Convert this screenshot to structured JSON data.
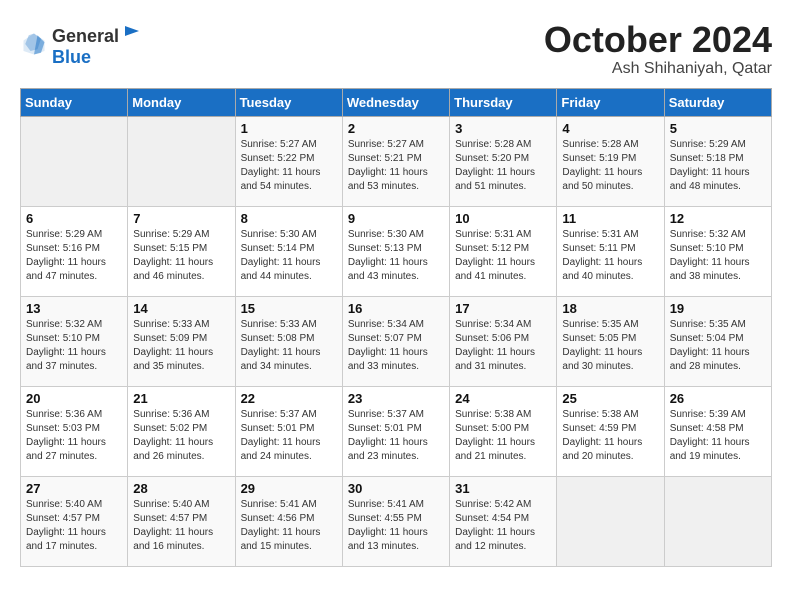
{
  "logo": {
    "general": "General",
    "blue": "Blue"
  },
  "title": "October 2024",
  "subtitle": "Ash Shihaniyah, Qatar",
  "days_of_week": [
    "Sunday",
    "Monday",
    "Tuesday",
    "Wednesday",
    "Thursday",
    "Friday",
    "Saturday"
  ],
  "weeks": [
    [
      {
        "day": "",
        "info": ""
      },
      {
        "day": "",
        "info": ""
      },
      {
        "day": "1",
        "info": "Sunrise: 5:27 AM\nSunset: 5:22 PM\nDaylight: 11 hours and 54 minutes."
      },
      {
        "day": "2",
        "info": "Sunrise: 5:27 AM\nSunset: 5:21 PM\nDaylight: 11 hours and 53 minutes."
      },
      {
        "day": "3",
        "info": "Sunrise: 5:28 AM\nSunset: 5:20 PM\nDaylight: 11 hours and 51 minutes."
      },
      {
        "day": "4",
        "info": "Sunrise: 5:28 AM\nSunset: 5:19 PM\nDaylight: 11 hours and 50 minutes."
      },
      {
        "day": "5",
        "info": "Sunrise: 5:29 AM\nSunset: 5:18 PM\nDaylight: 11 hours and 48 minutes."
      }
    ],
    [
      {
        "day": "6",
        "info": "Sunrise: 5:29 AM\nSunset: 5:16 PM\nDaylight: 11 hours and 47 minutes."
      },
      {
        "day": "7",
        "info": "Sunrise: 5:29 AM\nSunset: 5:15 PM\nDaylight: 11 hours and 46 minutes."
      },
      {
        "day": "8",
        "info": "Sunrise: 5:30 AM\nSunset: 5:14 PM\nDaylight: 11 hours and 44 minutes."
      },
      {
        "day": "9",
        "info": "Sunrise: 5:30 AM\nSunset: 5:13 PM\nDaylight: 11 hours and 43 minutes."
      },
      {
        "day": "10",
        "info": "Sunrise: 5:31 AM\nSunset: 5:12 PM\nDaylight: 11 hours and 41 minutes."
      },
      {
        "day": "11",
        "info": "Sunrise: 5:31 AM\nSunset: 5:11 PM\nDaylight: 11 hours and 40 minutes."
      },
      {
        "day": "12",
        "info": "Sunrise: 5:32 AM\nSunset: 5:10 PM\nDaylight: 11 hours and 38 minutes."
      }
    ],
    [
      {
        "day": "13",
        "info": "Sunrise: 5:32 AM\nSunset: 5:10 PM\nDaylight: 11 hours and 37 minutes."
      },
      {
        "day": "14",
        "info": "Sunrise: 5:33 AM\nSunset: 5:09 PM\nDaylight: 11 hours and 35 minutes."
      },
      {
        "day": "15",
        "info": "Sunrise: 5:33 AM\nSunset: 5:08 PM\nDaylight: 11 hours and 34 minutes."
      },
      {
        "day": "16",
        "info": "Sunrise: 5:34 AM\nSunset: 5:07 PM\nDaylight: 11 hours and 33 minutes."
      },
      {
        "day": "17",
        "info": "Sunrise: 5:34 AM\nSunset: 5:06 PM\nDaylight: 11 hours and 31 minutes."
      },
      {
        "day": "18",
        "info": "Sunrise: 5:35 AM\nSunset: 5:05 PM\nDaylight: 11 hours and 30 minutes."
      },
      {
        "day": "19",
        "info": "Sunrise: 5:35 AM\nSunset: 5:04 PM\nDaylight: 11 hours and 28 minutes."
      }
    ],
    [
      {
        "day": "20",
        "info": "Sunrise: 5:36 AM\nSunset: 5:03 PM\nDaylight: 11 hours and 27 minutes."
      },
      {
        "day": "21",
        "info": "Sunrise: 5:36 AM\nSunset: 5:02 PM\nDaylight: 11 hours and 26 minutes."
      },
      {
        "day": "22",
        "info": "Sunrise: 5:37 AM\nSunset: 5:01 PM\nDaylight: 11 hours and 24 minutes."
      },
      {
        "day": "23",
        "info": "Sunrise: 5:37 AM\nSunset: 5:01 PM\nDaylight: 11 hours and 23 minutes."
      },
      {
        "day": "24",
        "info": "Sunrise: 5:38 AM\nSunset: 5:00 PM\nDaylight: 11 hours and 21 minutes."
      },
      {
        "day": "25",
        "info": "Sunrise: 5:38 AM\nSunset: 4:59 PM\nDaylight: 11 hours and 20 minutes."
      },
      {
        "day": "26",
        "info": "Sunrise: 5:39 AM\nSunset: 4:58 PM\nDaylight: 11 hours and 19 minutes."
      }
    ],
    [
      {
        "day": "27",
        "info": "Sunrise: 5:40 AM\nSunset: 4:57 PM\nDaylight: 11 hours and 17 minutes."
      },
      {
        "day": "28",
        "info": "Sunrise: 5:40 AM\nSunset: 4:57 PM\nDaylight: 11 hours and 16 minutes."
      },
      {
        "day": "29",
        "info": "Sunrise: 5:41 AM\nSunset: 4:56 PM\nDaylight: 11 hours and 15 minutes."
      },
      {
        "day": "30",
        "info": "Sunrise: 5:41 AM\nSunset: 4:55 PM\nDaylight: 11 hours and 13 minutes."
      },
      {
        "day": "31",
        "info": "Sunrise: 5:42 AM\nSunset: 4:54 PM\nDaylight: 11 hours and 12 minutes."
      },
      {
        "day": "",
        "info": ""
      },
      {
        "day": "",
        "info": ""
      }
    ]
  ]
}
